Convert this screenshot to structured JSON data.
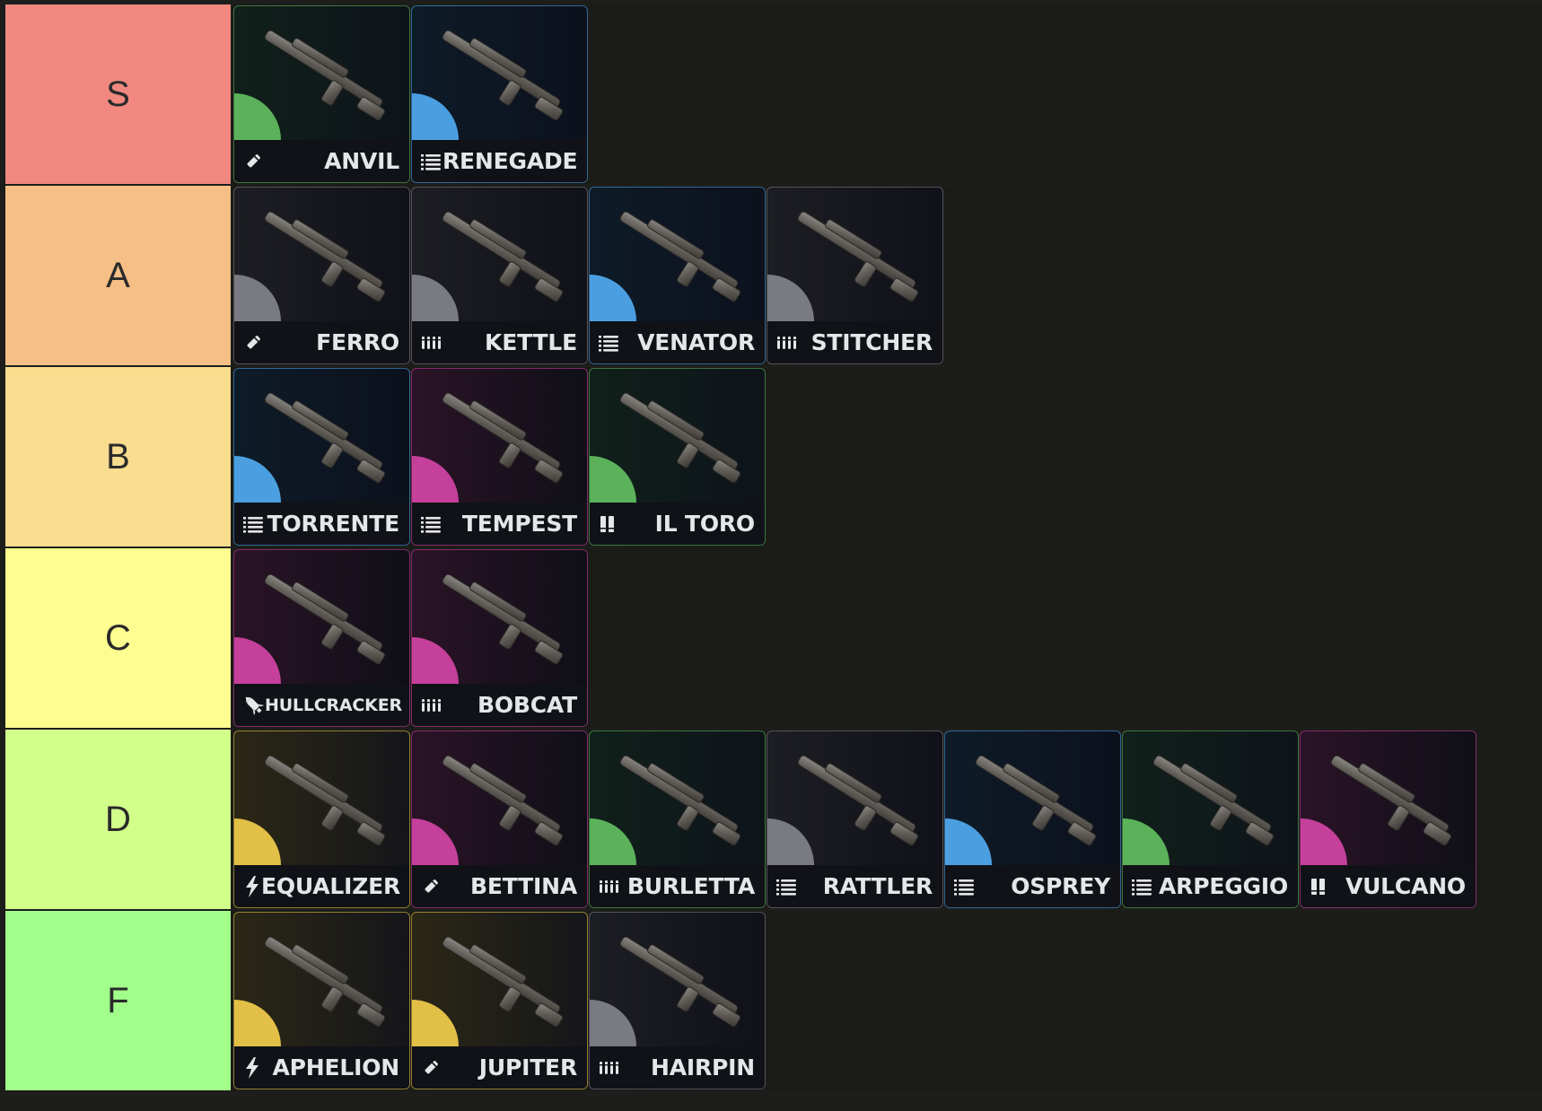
{
  "rarity_colors": {
    "grey": "#7a7a82",
    "green": "#5bb25a",
    "blue": "#4b9fe0",
    "purple": "#c4409b",
    "gold": "#e2bf47"
  },
  "ammo_icons": {
    "light": "bullet-icon",
    "medium": "stacked-rounds-icon",
    "heavy": "heavy-rounds-icon",
    "shotgun": "shotgun-shells-icon",
    "energy": "lightning-icon",
    "launcher": "rocket-icon"
  },
  "tiers": [
    {
      "label": "S",
      "color": "#f08880",
      "items": [
        {
          "name": "ANVIL",
          "rarity": "green",
          "ammo": "bullet-icon"
        },
        {
          "name": "RENEGADE",
          "rarity": "blue",
          "ammo": "stacked-rounds-icon"
        }
      ]
    },
    {
      "label": "A",
      "color": "#f6bf86",
      "items": [
        {
          "name": "FERRO",
          "rarity": "grey",
          "ammo": "bullet-icon"
        },
        {
          "name": "KETTLE",
          "rarity": "grey",
          "ammo": "heavy-rounds-icon"
        },
        {
          "name": "VENATOR",
          "rarity": "blue",
          "ammo": "stacked-rounds-icon"
        },
        {
          "name": "STITCHER",
          "rarity": "grey",
          "ammo": "heavy-rounds-icon"
        }
      ]
    },
    {
      "label": "B",
      "color": "#f8dd8e",
      "items": [
        {
          "name": "TORRENTE",
          "rarity": "blue",
          "ammo": "stacked-rounds-icon"
        },
        {
          "name": "TEMPEST",
          "rarity": "purple",
          "ammo": "stacked-rounds-icon"
        },
        {
          "name": "IL TORO",
          "rarity": "green",
          "ammo": "shotgun-shells-icon"
        }
      ]
    },
    {
      "label": "C",
      "color": "#fdfe8f",
      "items": [
        {
          "name": "HULLCRACKER",
          "rarity": "purple",
          "ammo": "rocket-icon"
        },
        {
          "name": "BOBCAT",
          "rarity": "purple",
          "ammo": "heavy-rounds-icon"
        }
      ]
    },
    {
      "label": "D",
      "color": "#d2fe8a",
      "items": [
        {
          "name": "EQUALIZER",
          "rarity": "gold",
          "ammo": "lightning-icon"
        },
        {
          "name": "BETTINA",
          "rarity": "purple",
          "ammo": "bullet-icon"
        },
        {
          "name": "BURLETTA",
          "rarity": "green",
          "ammo": "heavy-rounds-icon"
        },
        {
          "name": "RATTLER",
          "rarity": "grey",
          "ammo": "stacked-rounds-icon"
        },
        {
          "name": "OSPREY",
          "rarity": "blue",
          "ammo": "stacked-rounds-icon"
        },
        {
          "name": "ARPEGGIO",
          "rarity": "green",
          "ammo": "stacked-rounds-icon"
        },
        {
          "name": "VULCANO",
          "rarity": "purple",
          "ammo": "shotgun-shells-icon"
        }
      ]
    },
    {
      "label": "F",
      "color": "#a2fe8b",
      "items": [
        {
          "name": "APHELION",
          "rarity": "gold",
          "ammo": "lightning-icon"
        },
        {
          "name": "JUPITER",
          "rarity": "gold",
          "ammo": "bullet-icon"
        },
        {
          "name": "HAIRPIN",
          "rarity": "grey",
          "ammo": "heavy-rounds-icon"
        }
      ]
    }
  ]
}
